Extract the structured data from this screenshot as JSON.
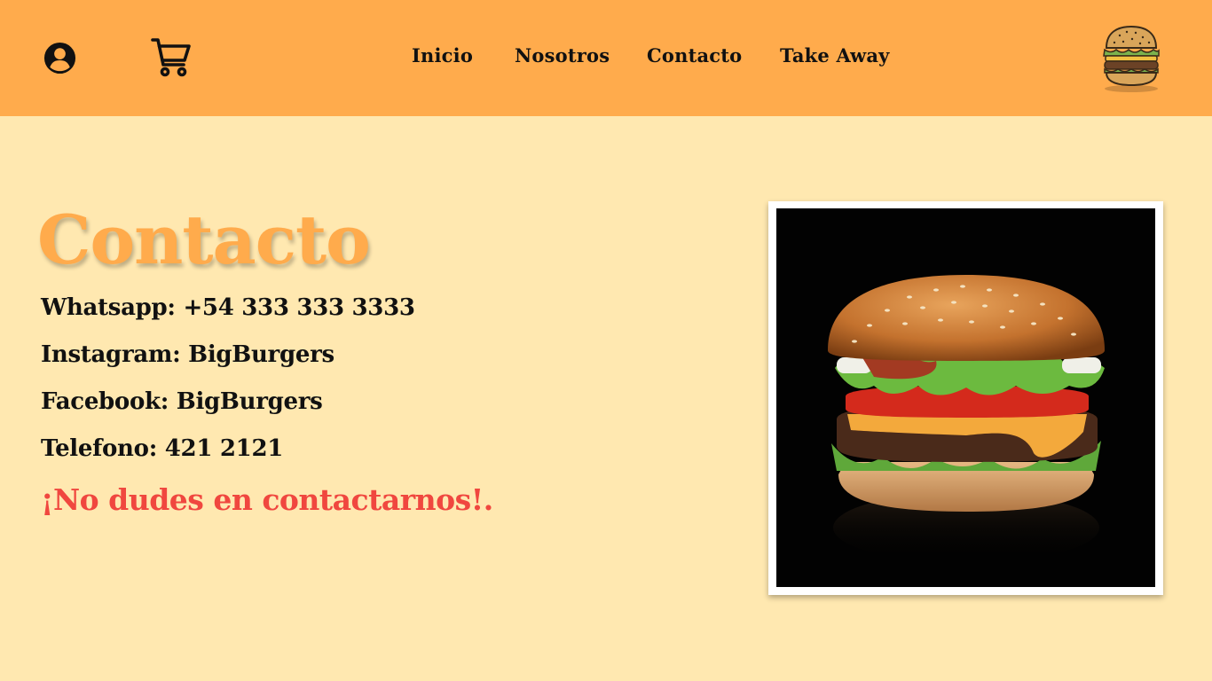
{
  "header": {
    "nav": [
      "Inicio",
      "Nosotros",
      "Contacto",
      "Take Away"
    ],
    "user_icon": "user-circle-icon",
    "cart_icon": "shopping-cart-icon",
    "logo_icon": "burger-logo-icon"
  },
  "main": {
    "title": "Contacto",
    "contacts": [
      "Whatsapp: +54 333 333 3333",
      "Instagram: BigBurgers",
      "Facebook: BigBurgers",
      "Telefono: 421 2121"
    ],
    "cta": "¡No dudes en contactarnos!."
  },
  "colors": {
    "header_bg": "#ffab4c",
    "page_bg": "#ffe8b0",
    "title": "#ffab4c",
    "cta": "#f0473f"
  }
}
